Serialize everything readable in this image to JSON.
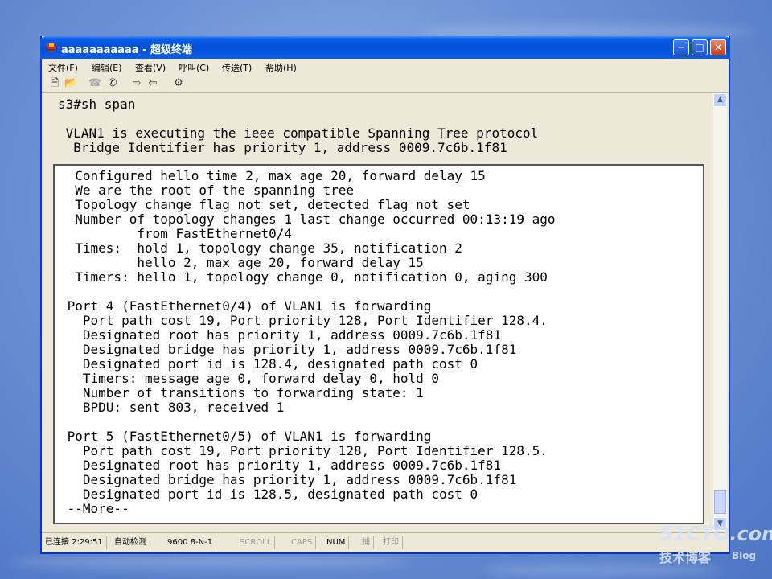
{
  "window": {
    "title": "aaaaaaaaaaa - 超级终端"
  },
  "menu": [
    "文件(F)",
    "编辑(E)",
    "查看(V)",
    "呼叫(C)",
    "传送(T)",
    "帮助(H)"
  ],
  "toolbar": [
    "new-icon",
    "open-icon",
    "disconnect-icon",
    "dial-icon",
    "send-icon",
    "receive-icon",
    "properties-icon"
  ],
  "terminal": {
    "lines_top": [
      "s3#sh span",
      "",
      " VLAN1 is executing the ieee compatible Spanning Tree protocol",
      "  Bridge Identifier has priority 1, address 0009.7c6b.1f81"
    ],
    "lines_inset": [
      "  Configured hello time 2, max age 20, forward delay 15",
      "  We are the root of the spanning tree",
      "  Topology change flag not set, detected flag not set",
      "  Number of topology changes 1 last change occurred 00:13:19 ago",
      "          from FastEthernet0/4",
      "  Times:  hold 1, topology change 35, notification 2",
      "          hello 2, max age 20, forward delay 15",
      "  Timers: hello 1, topology change 0, notification 0, aging 300",
      "",
      " Port 4 (FastEthernet0/4) of VLAN1 is forwarding",
      "   Port path cost 19, Port priority 128, Port Identifier 128.4.",
      "   Designated root has priority 1, address 0009.7c6b.1f81",
      "   Designated bridge has priority 1, address 0009.7c6b.1f81",
      "   Designated port id is 128.4, designated path cost 0",
      "   Timers: message age 0, forward delay 0, hold 0",
      "   Number of transitions to forwarding state: 1",
      "   BPDU: sent 803, received 1",
      "",
      " Port 5 (FastEthernet0/5) of VLAN1 is forwarding",
      "   Port path cost 19, Port priority 128, Port Identifier 128.5.",
      "   Designated root has priority 1, address 0009.7c6b.1f81",
      "   Designated bridge has priority 1, address 0009.7c6b.1f81",
      "   Designated port id is 128.5, designated path cost 0",
      " --More--"
    ]
  },
  "status": {
    "connection": "已连接 2:29:51",
    "detect": "自动检测",
    "settings": "9600 8-N-1",
    "scroll": "SCROLL",
    "caps": "CAPS",
    "num": "NUM",
    "capture": "捕",
    "print": "打印"
  },
  "watermark": {
    "main": "51CTO.com",
    "sub": "技术博客",
    "blog": "Blog"
  }
}
